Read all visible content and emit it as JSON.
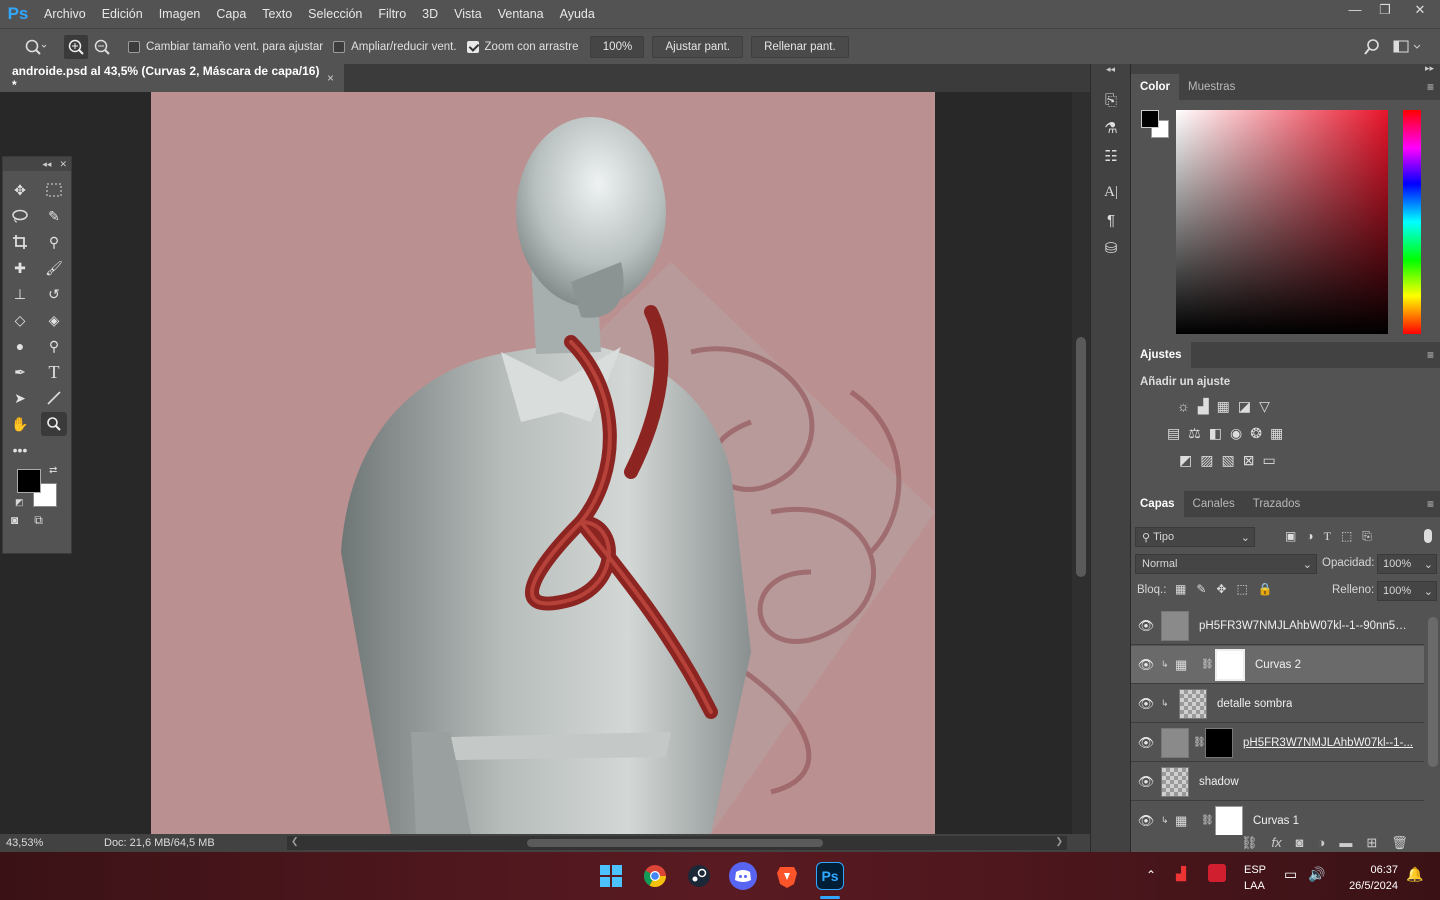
{
  "app": {
    "logo": "Ps"
  },
  "menu": [
    "Archivo",
    "Edición",
    "Imagen",
    "Capa",
    "Texto",
    "Selección",
    "Filtro",
    "3D",
    "Vista",
    "Ventana",
    "Ayuda"
  ],
  "window_controls": {
    "minimize": "—",
    "restore": "❐",
    "close": "✕"
  },
  "options": {
    "resize_windows": {
      "label": "Cambiar tamaño vent. para ajustar",
      "checked": false
    },
    "zoom_all": {
      "label": "Ampliar/reducir vent.",
      "checked": false
    },
    "scrubby_zoom": {
      "label": "Zoom con arrastre",
      "checked": true
    },
    "zoom_value": "100%",
    "fit_screen": "Ajustar pant.",
    "fill_screen": "Rellenar pant."
  },
  "document": {
    "tab_title": "androide.psd al 43,5% (Curvas 2, Máscara de capa/16) *",
    "close": "×"
  },
  "status": {
    "zoom": "43,53%",
    "doc": "Doc: 21,6 MB/64,5 MB",
    "arrow": "❯",
    "left": "❮",
    "right": "❯"
  },
  "panels": {
    "color_tabs": [
      "Color",
      "Muestras"
    ],
    "adjust_tab": "Ajustes",
    "adjust_subtitle": "Añadir un ajuste",
    "layers_tabs": [
      "Capas",
      "Canales",
      "Trazados"
    ],
    "filter_kind": "Tipo",
    "blend_mode": "Normal",
    "opacity_label": "Opacidad:",
    "opacity_value": "100%",
    "lock_label": "Bloq.:",
    "fill_label": "Relleno:",
    "fill_value": "100%"
  },
  "layers": [
    {
      "name": "pH5FR3W7NMJLAhbW07kl--1--90nn5 c...",
      "selected": false
    },
    {
      "name": "Curvas 2",
      "selected": true
    },
    {
      "name": "detalle sombra",
      "selected": false
    },
    {
      "name": "pH5FR3W7NMJLAhbW07kl--1-...",
      "selected": false
    },
    {
      "name": "shadow",
      "selected": false
    },
    {
      "name": "Curvas 1",
      "selected": false
    }
  ],
  "taskbar": {
    "lang_top": "ESP",
    "lang_bottom": "LAA",
    "time": "06:37",
    "date": "26/5/2024",
    "ps": "Ps"
  },
  "colors": {
    "accent": "#31a8ff",
    "canvas_bg": "#bb9090",
    "panel": "#535353",
    "taskbar": "#4a1a20"
  }
}
